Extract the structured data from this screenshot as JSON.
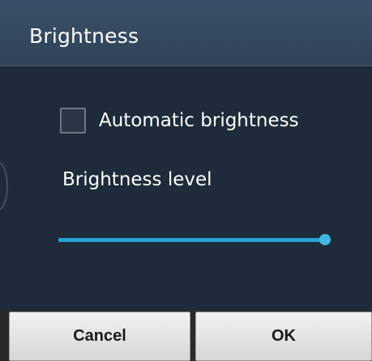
{
  "dialog": {
    "title": "Brightness",
    "automatic": {
      "label": "Automatic brightness",
      "checked": false
    },
    "level": {
      "label": "Brightness level",
      "value_fraction": 0.98
    },
    "buttons": {
      "cancel": "Cancel",
      "ok": "OK"
    }
  },
  "colors": {
    "background": "#1e2b3a",
    "title_bar": "#34495f",
    "slider_accent": "#27a3d0"
  }
}
